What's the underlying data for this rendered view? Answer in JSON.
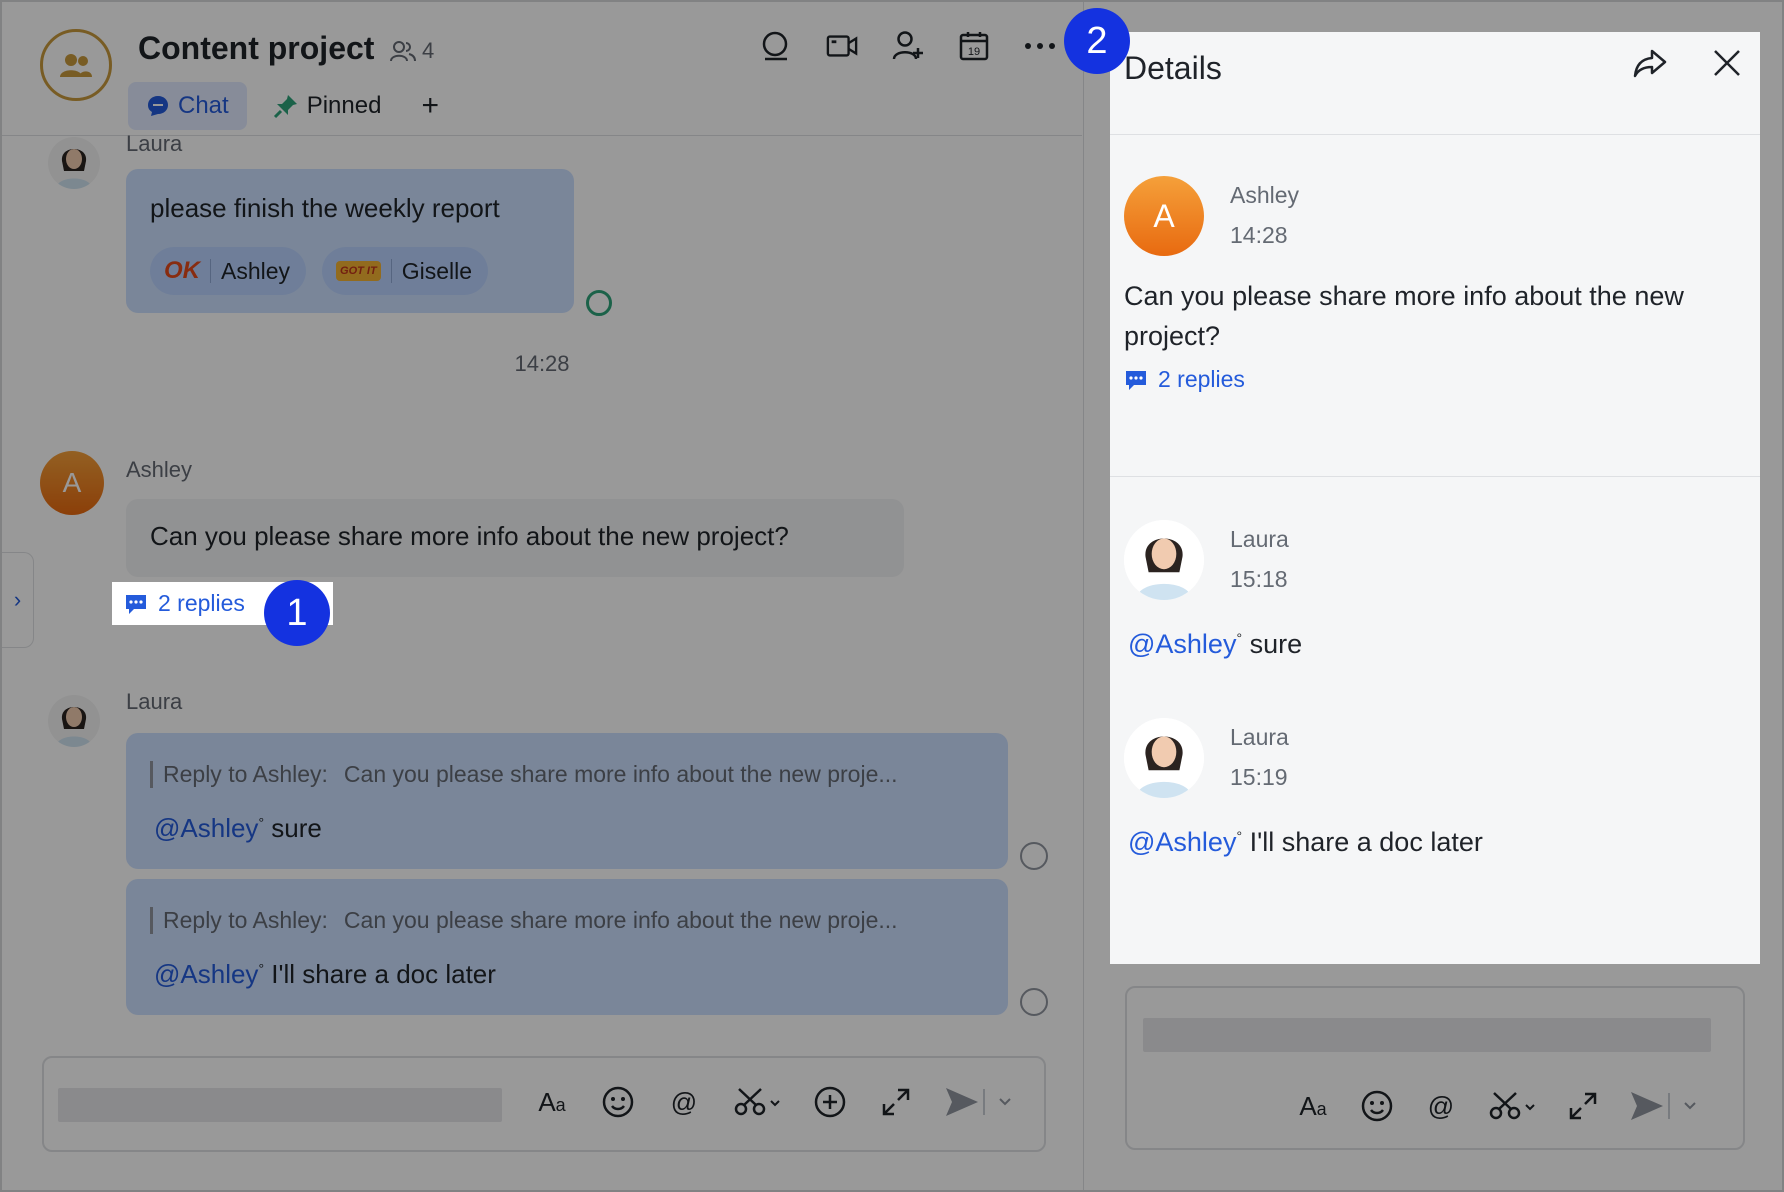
{
  "chat": {
    "title": "Content project",
    "member_count": "4",
    "tabs": [
      {
        "label": "Chat",
        "active": true
      },
      {
        "label": "Pinned",
        "active": false
      }
    ],
    "add_tab": "+",
    "header_icons": [
      "search-icon",
      "video-call-icon",
      "add-member-icon",
      "calendar-icon",
      "more-icon"
    ],
    "calendar_day": "19"
  },
  "messages": {
    "m1": {
      "sender": "Laura",
      "text": "please finish the weekly report",
      "reactions": [
        {
          "emoji": "OK",
          "user": "Ashley"
        },
        {
          "emoji": "GOT IT",
          "user": "Giselle"
        }
      ]
    },
    "time_divider": "14:28",
    "m2": {
      "sender": "Ashley",
      "avatar_letter": "A",
      "text": "Can you please share more info about the new project?",
      "replies": "2 replies"
    },
    "m3": {
      "sender": "Laura",
      "replies": [
        {
          "quote_label": "Reply to Ashley:",
          "quote_text": "Can you please share more info about the new proje...",
          "mention": "@Ashley",
          "text": "sure"
        },
        {
          "quote_label": "Reply to Ashley:",
          "quote_text": "Can you please share more info about the new proje...",
          "mention": "@Ashley",
          "text": "I'll share a doc later"
        }
      ]
    }
  },
  "composer": {
    "tools": [
      "format-icon",
      "emoji-icon",
      "mention-icon",
      "screenshot-icon",
      "add-icon",
      "expand-icon",
      "send-icon"
    ]
  },
  "details": {
    "title": "Details",
    "root": {
      "sender": "Ashley",
      "avatar_letter": "A",
      "time": "14:28",
      "text": "Can you please share more info about the new project?",
      "replies": "2 replies"
    },
    "replies": [
      {
        "sender": "Laura",
        "time": "15:18",
        "mention": "@Ashley",
        "text": "sure"
      },
      {
        "sender": "Laura",
        "time": "15:19",
        "mention": "@Ashley",
        "text": "I'll share a doc later"
      }
    ]
  },
  "callouts": [
    "1",
    "2"
  ],
  "colors": {
    "accent": "#245bdb",
    "callout": "#1432e0",
    "bubble_blue": "#cce0ff",
    "avatar_orange": "#e86a10"
  }
}
